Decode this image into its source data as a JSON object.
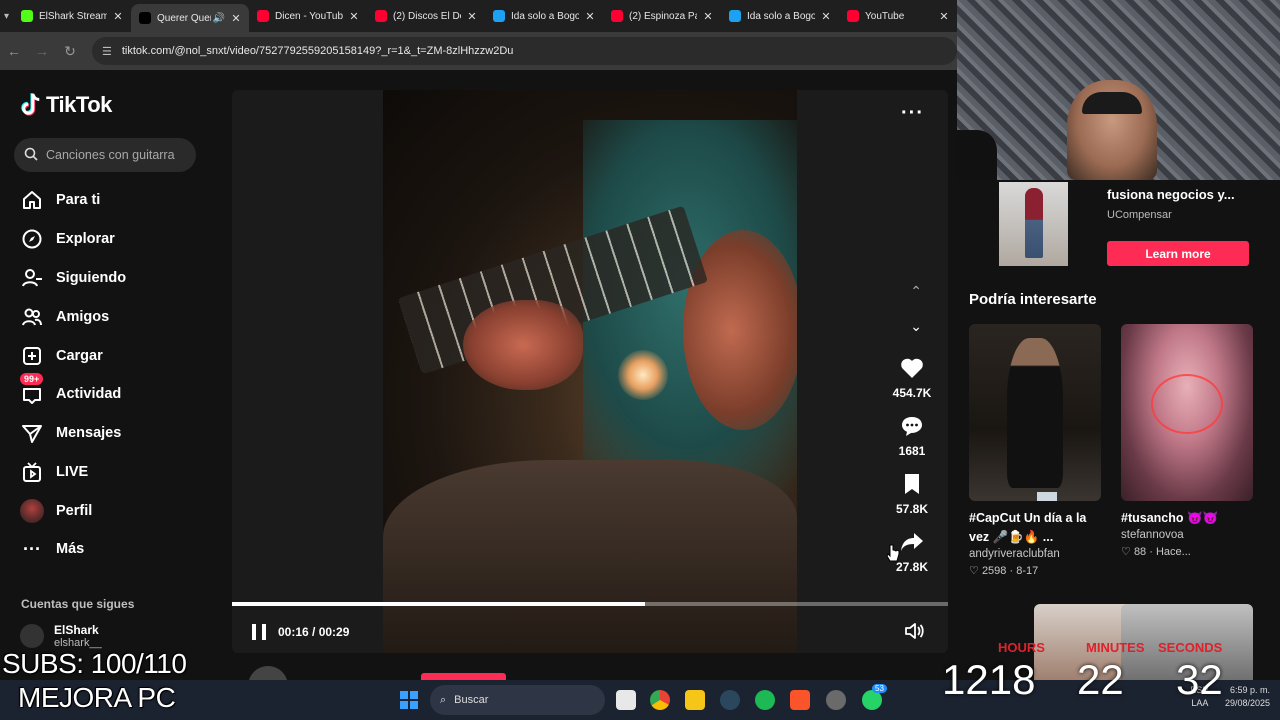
{
  "browser": {
    "tabs": [
      {
        "title": "ElShark Stream",
        "color": "#53fc18",
        "active": false
      },
      {
        "title": "Querer Quererte",
        "color": "#000000",
        "active": true
      },
      {
        "title": "Dicen - YouTube",
        "color": "#ff0033",
        "active": false
      },
      {
        "title": "(2) Discos El Dorado",
        "color": "#ff0033",
        "active": false
      },
      {
        "title": "Ida solo a Bogotá",
        "color": "#1da1f2",
        "active": false
      },
      {
        "title": "(2) Espinoza Paz",
        "color": "#ff0033",
        "active": false
      },
      {
        "title": "Ida solo a Bogotá",
        "color": "#1da1f2",
        "active": false
      },
      {
        "title": "YouTube",
        "color": "#ff0033",
        "active": false
      }
    ],
    "url": "tiktok.com/@nol_snxt/video/7527792559205158149?_r=1&_t=ZM-8zlHhzzw2Du"
  },
  "tiktok": {
    "brand": "TikTok",
    "search_placeholder": "Canciones con guitarra",
    "nav": [
      {
        "label": "Para ti",
        "icon": "home-icon"
      },
      {
        "label": "Explorar",
        "icon": "compass-icon"
      },
      {
        "label": "Siguiendo",
        "icon": "user-follow-icon"
      },
      {
        "label": "Amigos",
        "icon": "friends-icon"
      },
      {
        "label": "Cargar",
        "icon": "upload-icon"
      },
      {
        "label": "Actividad",
        "icon": "inbox-icon",
        "badge": "99+"
      },
      {
        "label": "Mensajes",
        "icon": "send-icon"
      },
      {
        "label": "LIVE",
        "icon": "live-icon"
      },
      {
        "label": "Perfil",
        "icon": "avatar-icon"
      },
      {
        "label": "Más",
        "icon": "more-icon"
      }
    ],
    "following_heading": "Cuentas que sigues",
    "following": [
      {
        "name": "ElShark",
        "handle": "elshark__"
      }
    ],
    "video": {
      "likes": "454.7K",
      "comments": "1681",
      "saves": "57.8K",
      "shares": "27.8K",
      "time": "00:16 / 00:29",
      "progress": 0.577,
      "author": "nol_snxt"
    },
    "ad": {
      "title": "fusiona negocios y...",
      "sponsor": "UCompensar",
      "cta": "Learn more"
    },
    "suggestions_heading": "Podría interesarte",
    "suggestions": [
      {
        "title": "#CapCut Un día a la vez 🎤🍺🔥 ...",
        "user": "andyriveraclubfan",
        "likes": "2598",
        "date": "8-17"
      },
      {
        "title": "#tusancho 😈😈",
        "user": "stefannovoa",
        "likes": "88",
        "date": "Hace..."
      }
    ]
  },
  "overlay": {
    "subs": "SUBS: 100/110",
    "mejora": "MEJORA PC",
    "timer": {
      "hours_label": "HOURS",
      "minutes_label": "MINUTES",
      "seconds_label": "SECONDS",
      "hours": "1218",
      "minutes": "22",
      "seconds": "32"
    }
  },
  "taskbar": {
    "search": "Buscar",
    "lang": "ESP",
    "lang2": "LAA",
    "time": "6:59 p. m.",
    "date": "29/08/2025",
    "whatsapp_badge": "53"
  },
  "colors": {
    "accent": "#fe2c55",
    "bg": "#121212"
  }
}
